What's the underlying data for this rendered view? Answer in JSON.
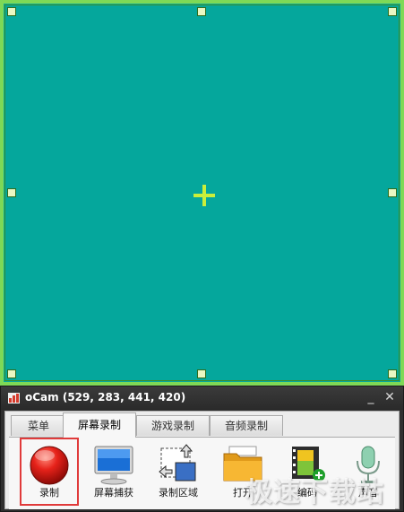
{
  "window": {
    "title": "oCam (529, 283, 441, 420)",
    "minimize_glyph": "_",
    "close_glyph": "✕"
  },
  "menu_tabs": [
    {
      "label": "菜单",
      "active": false
    },
    {
      "label": "屏幕录制",
      "active": true
    },
    {
      "label": "游戏录制",
      "active": false
    },
    {
      "label": "音频录制",
      "active": false
    }
  ],
  "tools": [
    {
      "label": "录制",
      "icon": "record-icon",
      "selected": true
    },
    {
      "label": "屏幕捕获",
      "icon": "monitor-icon",
      "selected": false
    },
    {
      "label": "录制区域",
      "icon": "resize-region-icon",
      "selected": false
    },
    {
      "label": "打开",
      "icon": "folder-icon",
      "selected": false
    },
    {
      "label": "编码",
      "icon": "codec-film-icon",
      "selected": false
    },
    {
      "label": "声音",
      "icon": "microphone-icon",
      "selected": false
    }
  ],
  "watermark": {
    "text": "极速下载站"
  },
  "colors": {
    "capture_fill": "#05a79c",
    "capture_border": "#7ed957",
    "crosshair": "#c9ef3a",
    "selected_outline": "#e03a3a"
  }
}
